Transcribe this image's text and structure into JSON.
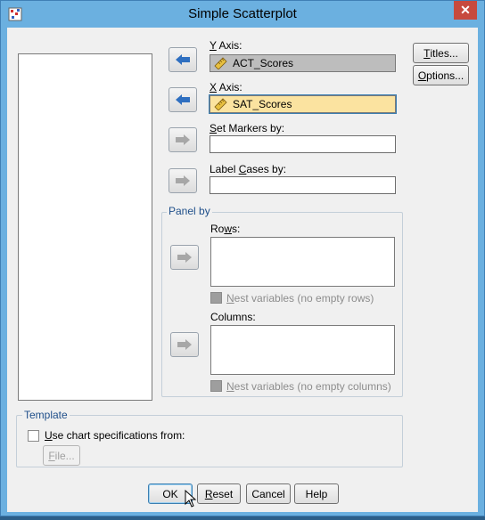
{
  "window": {
    "title": "Simple Scatterplot",
    "close_glyph": "✕",
    "accent": "#6bb0e0",
    "close_color": "#c74a3e"
  },
  "variable_list": {
    "items": []
  },
  "y_axis": {
    "label_prefix": "Y",
    "label_rest": " Axis:",
    "value": "ACT_Scores",
    "icon": "scale-ruler-icon"
  },
  "x_axis": {
    "label_prefix": "X",
    "label_rest": " Axis:",
    "value": "SAT_Scores",
    "icon": "scale-ruler-icon"
  },
  "set_markers": {
    "label_prefix": "S",
    "label_rest": "et Markers by:",
    "value": ""
  },
  "label_cases": {
    "label_before": "Label ",
    "label_prefix": "C",
    "label_rest": "ases by:",
    "value": ""
  },
  "panel_by": {
    "title": "Panel by",
    "rows_label_before": "Ro",
    "rows_label_prefix": "w",
    "rows_label_rest": "s:",
    "rows_nest_prefix": "N",
    "rows_nest_rest": "est variables (no empty rows)",
    "columns_label": "Columns:",
    "columns_nest_prefix": "N",
    "columns_nest_rest": "est variables (no empty columns)"
  },
  "template": {
    "title": "Template",
    "use_prefix": "U",
    "use_rest": "se chart specifications from:",
    "file_prefix": "F",
    "file_rest": "ile..."
  },
  "side_buttons": {
    "titles_prefix": "T",
    "titles_rest": "itles...",
    "options_prefix": "O",
    "options_rest": "ptions..."
  },
  "footer": {
    "ok": "OK",
    "reset_prefix": "R",
    "reset_rest": "eset",
    "cancel": "Cancel",
    "help": "Help"
  }
}
